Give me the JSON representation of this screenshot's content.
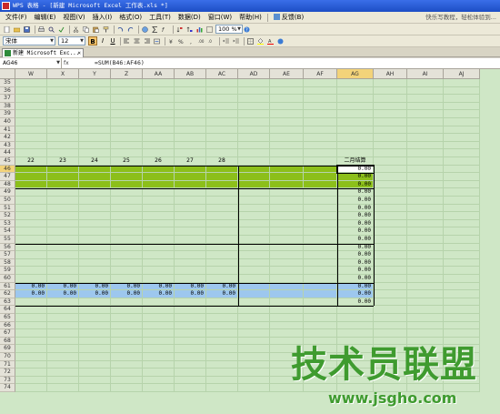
{
  "window": {
    "title": "WPS 表格 - [新建 Microsoft Excel 工作表.xls *]"
  },
  "menu": {
    "items": [
      {
        "label": "文件(F)",
        "name": "menu-file"
      },
      {
        "label": "编辑(E)",
        "name": "menu-edit"
      },
      {
        "label": "视图(V)",
        "name": "menu-view"
      },
      {
        "label": "插入(I)",
        "name": "menu-insert"
      },
      {
        "label": "格式(O)",
        "name": "menu-format"
      },
      {
        "label": "工具(T)",
        "name": "menu-tools"
      },
      {
        "label": "数据(D)",
        "name": "menu-data"
      },
      {
        "label": "窗口(W)",
        "name": "menu-window"
      },
      {
        "label": "帮助(H)",
        "name": "menu-help"
      },
      {
        "label": "反馈(B)",
        "name": "menu-feedback"
      }
    ],
    "help_hint": "快乐写教程，轻松体验到..."
  },
  "toolbar": {
    "zoom": "100 %",
    "font_name": "宋体",
    "font_size": "12",
    "bold_label": "B",
    "italic_label": "I",
    "underline_label": "U"
  },
  "document_tab": {
    "label": "新建 Microsoft Exc..."
  },
  "formula_bar": {
    "cell_ref": "AG46",
    "fx_label": "fx",
    "formula": "=SUM(B46:AF46)"
  },
  "sheet": {
    "columns": [
      "W",
      "X",
      "Y",
      "Z",
      "AA",
      "AB",
      "AC",
      "AD",
      "AE",
      "AF",
      "AG",
      "AH",
      "AI",
      "AJ"
    ],
    "selected_column": "AG",
    "row_start": 35,
    "row_end": 74,
    "selected_row": 46,
    "header_row": 45,
    "header_row_values": [
      "22",
      "23",
      "24",
      "25",
      "26",
      "27",
      "28",
      "",
      "",
      "",
      "二月结算",
      "",
      "",
      ""
    ],
    "ag_values_from_row": 46,
    "ag_values_to_row": 63,
    "ag_value": "0.00",
    "blue_rows_values": {
      "61": "0.00",
      "62": "0.00"
    },
    "green_rows": [
      46,
      47,
      48
    ],
    "blue_rows": [
      61,
      62
    ],
    "green_color": "#8cbf1a",
    "blue_color": "#9dc7ee",
    "grid_bg": "#cfe7c6"
  },
  "watermark": {
    "title": "技术员联盟",
    "url": "www.jsgho.com"
  }
}
